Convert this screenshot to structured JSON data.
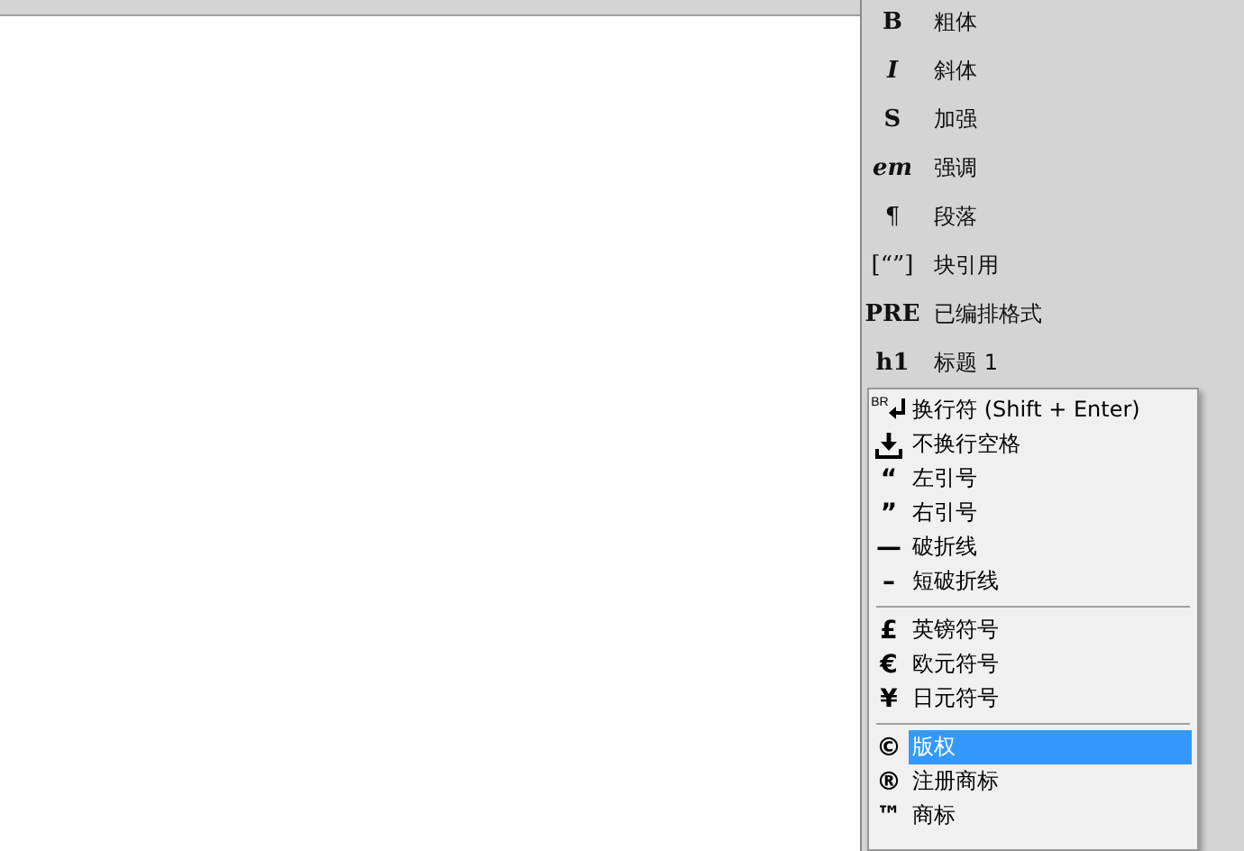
{
  "panel": {
    "items": [
      {
        "glyph": "B",
        "label": "粗体",
        "kind": "bold"
      },
      {
        "glyph": "I",
        "label": "斜体",
        "kind": "italic"
      },
      {
        "glyph": "S",
        "label": "加强",
        "kind": "bold"
      },
      {
        "glyph": "em",
        "label": "强调",
        "kind": "italic"
      },
      {
        "glyph": "¶",
        "label": "段落",
        "kind": "plain"
      },
      {
        "glyph": "[“”]",
        "label": "块引用",
        "kind": "plain"
      },
      {
        "glyph": "PRE",
        "label": "已编排格式",
        "kind": "bold"
      },
      {
        "glyph": "h1",
        "label": "标题 1",
        "kind": "bold"
      }
    ]
  },
  "menu": {
    "groups": [
      [
        {
          "kind": "br",
          "glyph": "BR",
          "label": "换行符 (Shift + Enter)",
          "selected": false
        },
        {
          "kind": "download",
          "label": "不换行空格",
          "selected": false
        },
        {
          "kind": "glyph",
          "glyph": "“",
          "label": "左引号",
          "selected": false
        },
        {
          "kind": "glyph",
          "glyph": "”",
          "label": "右引号",
          "selected": false
        },
        {
          "kind": "glyph",
          "glyph": "—",
          "label": "破折线",
          "selected": false
        },
        {
          "kind": "glyph",
          "glyph": "–",
          "label": "短破折线",
          "selected": false
        }
      ],
      [
        {
          "kind": "glyph",
          "glyph": "£",
          "label": "英镑符号",
          "selected": false
        },
        {
          "kind": "glyph",
          "glyph": "€",
          "label": "欧元符号",
          "selected": false
        },
        {
          "kind": "glyph",
          "glyph": "¥",
          "label": "日元符号",
          "selected": false
        }
      ],
      [
        {
          "kind": "glyph",
          "glyph": "©",
          "label": "版权",
          "selected": true
        },
        {
          "kind": "glyph",
          "glyph": "®",
          "label": "注册商标",
          "selected": false
        },
        {
          "kind": "glyph",
          "glyph": "™",
          "label": "商标",
          "selected": false
        }
      ]
    ]
  }
}
